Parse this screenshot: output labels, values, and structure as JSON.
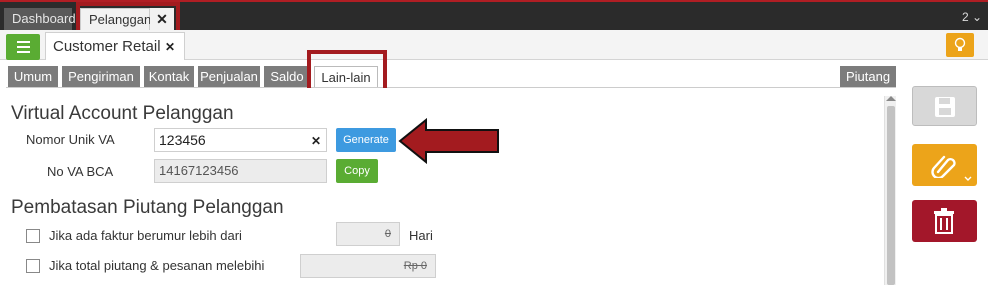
{
  "top_tabs": {
    "dashboard": "Dashboard",
    "pelanggan": "Pelanggan",
    "close_glyph": "✕",
    "count": "2 ⌄"
  },
  "doc": {
    "title": "Customer Retail",
    "close_glyph": "✕"
  },
  "section_tabs": [
    "Umum",
    "Pengiriman",
    "Kontak",
    "Penjualan",
    "Saldo",
    "Lain-lain"
  ],
  "right_tab": "Piutang",
  "active_tab": "Lain-lain",
  "va": {
    "heading": "Virtual Account Pelanggan",
    "nomor_label": "Nomor Unik VA",
    "nomor_value": "123456",
    "clear_glyph": "✕",
    "generate_label": "Generate",
    "bca_label": "No VA BCA",
    "bca_value": "14167123456",
    "copy_label": "Copy"
  },
  "limit": {
    "heading": "Pembatasan Piutang Pelanggan",
    "age_label": "Jika ada faktur berumur lebih dari",
    "age_value": "0",
    "age_unit": "Hari",
    "total_label": "Jika total piutang & pesanan melebihi",
    "total_value": "Rp 0"
  },
  "icons": [
    "menu-icon",
    "bulb-icon",
    "save-icon",
    "paperclip-icon",
    "trash-icon",
    "arrow-icon"
  ],
  "colors": {
    "green": "#5aac33",
    "blue": "#3d9ae0",
    "orange": "#eca41a",
    "red": "#a3172a",
    "highlight": "#a31b1f"
  }
}
